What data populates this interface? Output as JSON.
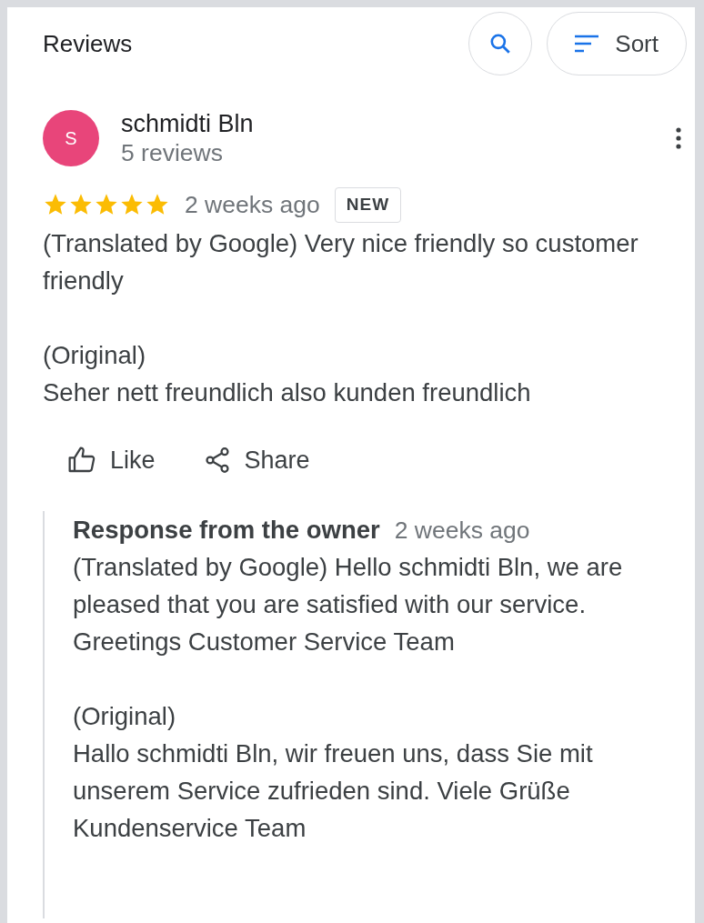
{
  "header": {
    "title": "Reviews",
    "sort_label": "Sort"
  },
  "review": {
    "avatar_letter": "S",
    "author": "schmidti Bln",
    "review_count": "5 reviews",
    "stars": 5,
    "time": "2 weeks ago",
    "badge": "NEW",
    "text": "(Translated by Google) Very nice friendly so customer friendly",
    "original_label": "(Original)",
    "original_text": "Seher nett freundlich also kunden freundlich"
  },
  "actions": [
    {
      "kind": "like",
      "label": "Like"
    },
    {
      "kind": "share",
      "label": "Share"
    }
  ],
  "owner_response": {
    "title": "Response from the owner",
    "time": "2 weeks ago",
    "text": "(Translated by Google) Hello schmidti Bln, we are pleased that you are satisfied with our service. Greetings Customer Service Team",
    "original_label": "(Original)",
    "original_text": "Hallo schmidti Bln, wir freuen uns, dass Sie mit unserem Service zufrieden sind. Viele Grüße Kundenservice Team"
  }
}
